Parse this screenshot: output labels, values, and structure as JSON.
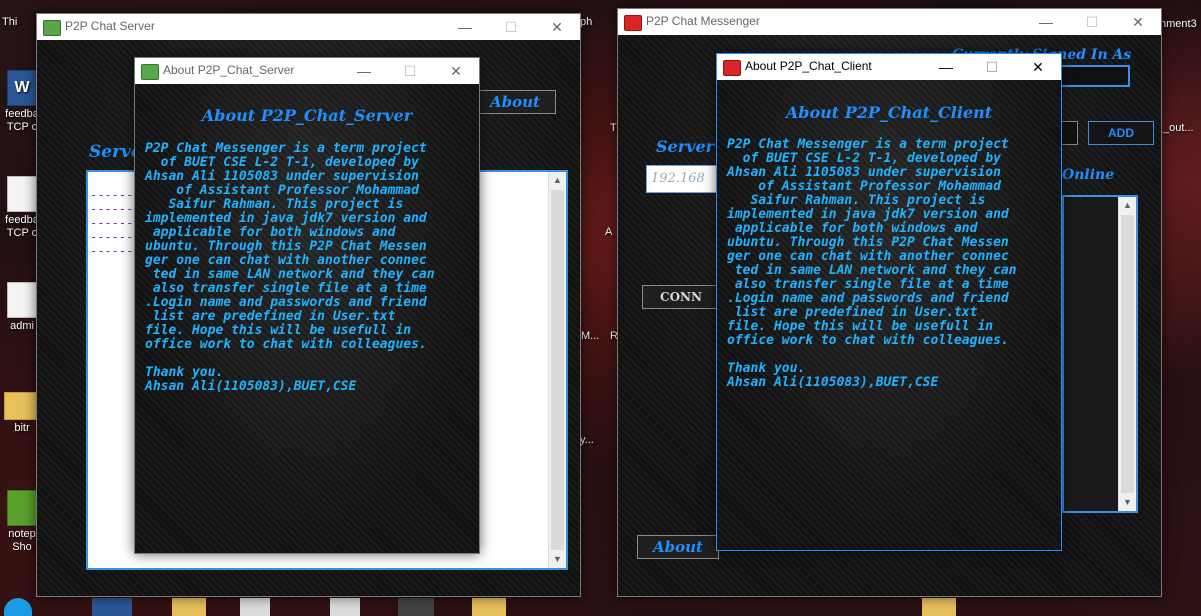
{
  "desktop": {
    "items": [
      {
        "label": "feedba\nTCP c",
        "icon": "word-document-icon"
      },
      {
        "label": "feedba\nTCP c",
        "icon": "document-icon"
      },
      {
        "label": "admi",
        "icon": "document-icon"
      },
      {
        "label": "bitr",
        "icon": "folder-icon"
      },
      {
        "label": "notep\nSho",
        "icon": "notepad-icon"
      }
    ],
    "fragments": {
      "thi": "Thi",
      "ph": "ph",
      "nment3": "nment3",
      "out": "_out...",
      "t": "T",
      "a": "A",
      "m": "M...",
      "r": "R",
      "y": "y..."
    }
  },
  "server_window": {
    "title": "P2P Chat Server",
    "minimize": "—",
    "maximize": "☐",
    "close": "✕",
    "server_label": "Serve",
    "about_button": "About",
    "log_lines": [
      "------",
      "------",
      "------",
      "------",
      "------"
    ]
  },
  "about_server": {
    "title": "About P2P_Chat_Server",
    "minimize": "—",
    "maximize": "☐",
    "close": "✕",
    "heading": "About P2P_Chat_Server",
    "body": "P2P Chat Messenger is a term project\n  of BUET CSE L-2 T-1, developed by\nAhsan Ali 1105083 under supervision\n    of Assistant Professor Mohammad\n   Saifur Rahman. This project is\nimplemented in java jdk7 version and\n applicable for both windows and\nubuntu. Through this P2P Chat Messen\nger one can chat with another connec\n ted in same LAN network and they can\n also transfer single file at a time\n.Login name and passwords and friend\n list are predefined in User.txt\nfile. Hope this will be usefull in\noffice work to chat with colleagues.\n\nThank you.\nAhsan Ali(1105083),BUET,CSE"
  },
  "messenger_window": {
    "title": "P2P Chat Messenger",
    "minimize": "—",
    "maximize": "☐",
    "close": "✕",
    "signed_in_label": "Currently Signed In As",
    "add_button": "ADD",
    "server_label": "Server",
    "ip_value": "192.168",
    "online_label": "Online",
    "connect_button": "CONN",
    "about_button": "About"
  },
  "about_client": {
    "title": "About P2P_Chat_Client",
    "minimize": "—",
    "maximize": "☐",
    "close": "✕",
    "heading": "About P2P_Chat_Client",
    "body": "P2P Chat Messenger is a term project\n  of BUET CSE L-2 T-1, developed by\nAhsan Ali 1105083 under supervision\n    of Assistant Professor Mohammad\n   Saifur Rahman. This project is\nimplemented in java jdk7 version and\n applicable for both windows and\nubuntu. Through this P2P Chat Messen\nger one can chat with another connec\n ted in same LAN network and they can\n also transfer single file at a time\n.Login name and passwords and friend\n list are predefined in User.txt\nfile. Hope this will be usefull in\noffice work to chat with colleagues.\n\nThank you.\nAhsan Ali(1105083),BUET,CSE"
  },
  "colors": {
    "accent_blue": "#1e90ff",
    "text_cyan": "#1fb3ff",
    "border_blue": "#3d8fe6"
  }
}
